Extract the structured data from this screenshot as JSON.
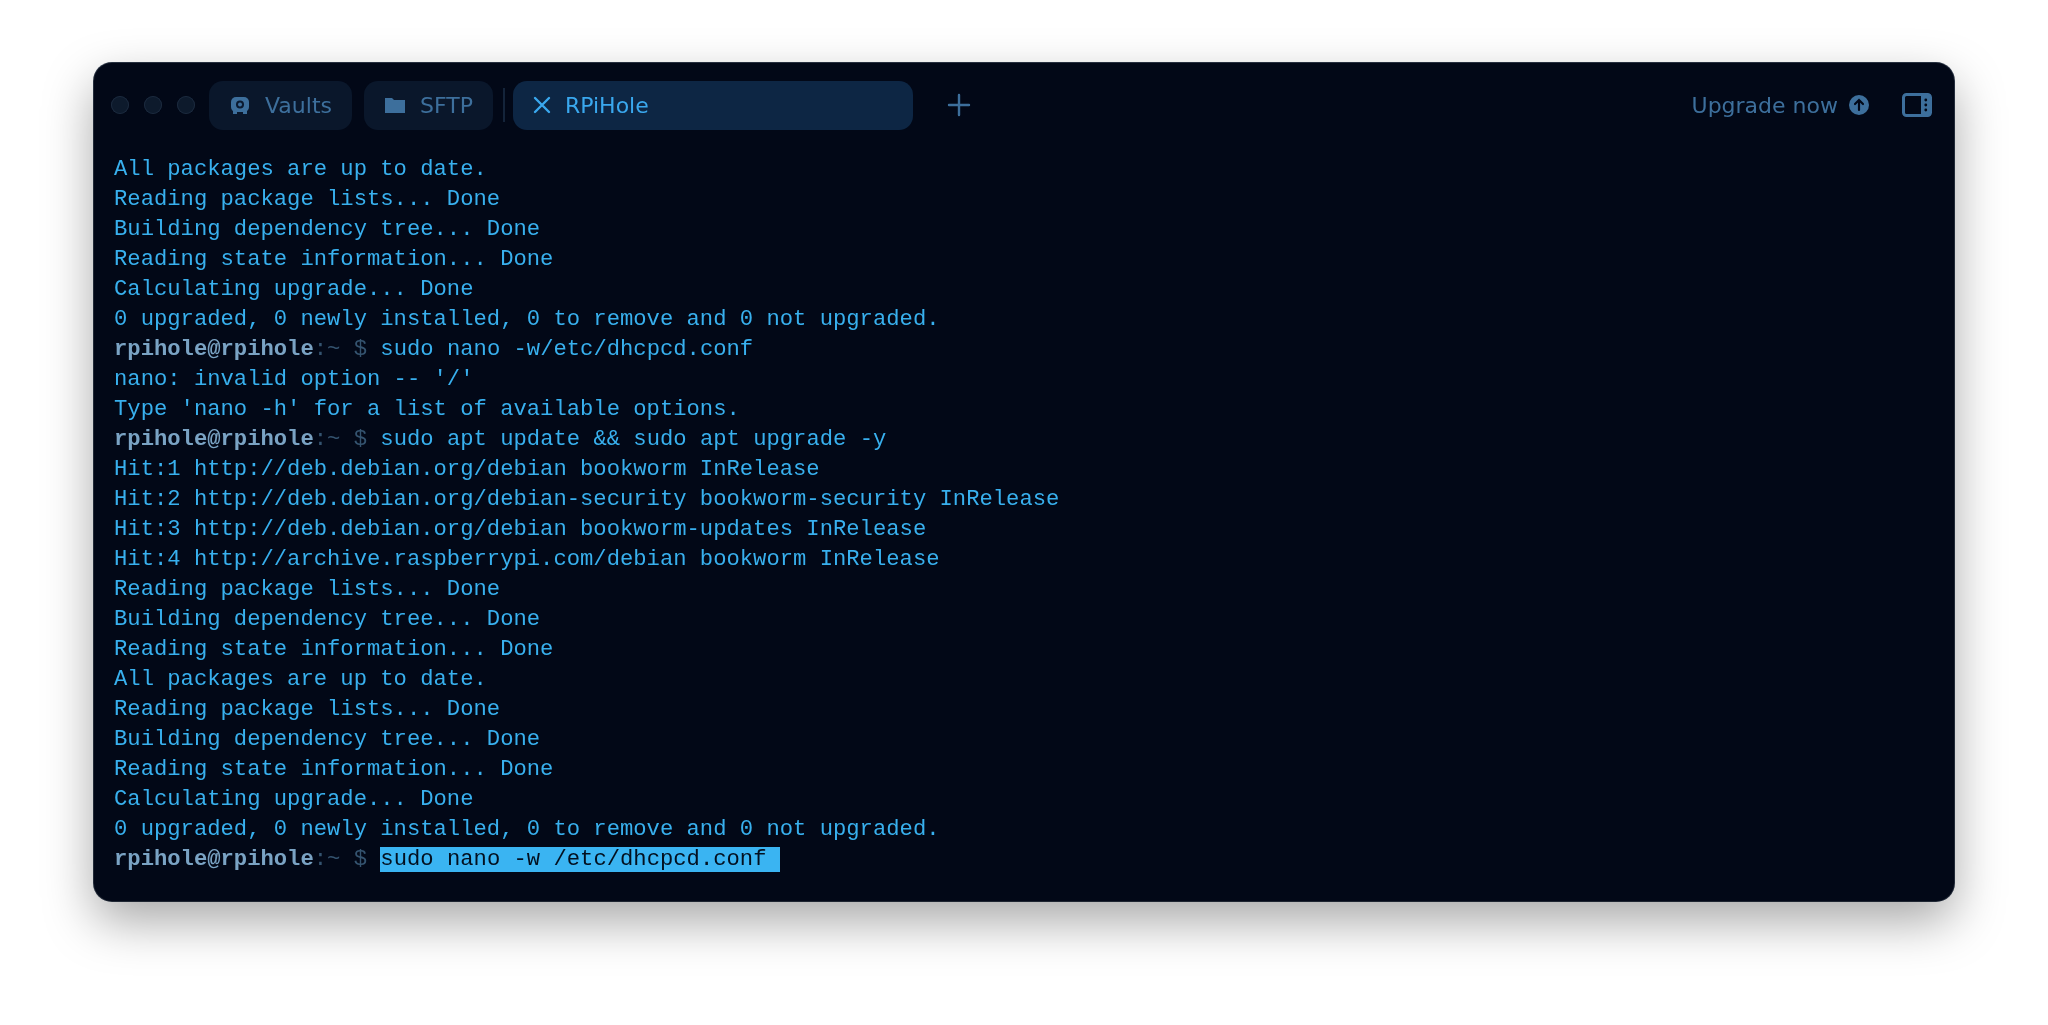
{
  "tabs": [
    {
      "label": "Vaults",
      "kind": "vault",
      "selected": false
    },
    {
      "label": "SFTP",
      "kind": "folder",
      "selected": false
    },
    {
      "label": "RPiHole",
      "kind": "session",
      "selected": true
    }
  ],
  "upgrade_link": "Upgrade now",
  "terminal": {
    "lines": [
      {
        "kind": "output",
        "text": "All packages are up to date."
      },
      {
        "kind": "output",
        "text": "Reading package lists... Done"
      },
      {
        "kind": "output",
        "text": "Building dependency tree... Done"
      },
      {
        "kind": "output",
        "text": "Reading state information... Done"
      },
      {
        "kind": "output",
        "text": "Calculating upgrade... Done"
      },
      {
        "kind": "output",
        "text": "0 upgraded, 0 newly installed, 0 to remove and 0 not upgraded."
      },
      {
        "kind": "prompt",
        "user": "rpihole@rpihole",
        "path": ":~",
        "symbol": "$",
        "command": "sudo nano -w/etc/dhcpcd.conf",
        "selected": false
      },
      {
        "kind": "output",
        "text": "nano: invalid option -- '/'"
      },
      {
        "kind": "output",
        "text": "Type 'nano -h' for a list of available options."
      },
      {
        "kind": "prompt",
        "user": "rpihole@rpihole",
        "path": ":~",
        "symbol": "$",
        "command": "sudo apt update && sudo apt upgrade -y",
        "selected": false
      },
      {
        "kind": "output",
        "text": "Hit:1 http://deb.debian.org/debian bookworm InRelease"
      },
      {
        "kind": "output",
        "text": "Hit:2 http://deb.debian.org/debian-security bookworm-security InRelease"
      },
      {
        "kind": "output",
        "text": "Hit:3 http://deb.debian.org/debian bookworm-updates InRelease"
      },
      {
        "kind": "output",
        "text": "Hit:4 http://archive.raspberrypi.com/debian bookworm InRelease"
      },
      {
        "kind": "output",
        "text": "Reading package lists... Done"
      },
      {
        "kind": "output",
        "text": "Building dependency tree... Done"
      },
      {
        "kind": "output",
        "text": "Reading state information... Done"
      },
      {
        "kind": "output",
        "text": "All packages are up to date."
      },
      {
        "kind": "output",
        "text": "Reading package lists... Done"
      },
      {
        "kind": "output",
        "text": "Building dependency tree... Done"
      },
      {
        "kind": "output",
        "text": "Reading state information... Done"
      },
      {
        "kind": "output",
        "text": "Calculating upgrade... Done"
      },
      {
        "kind": "output",
        "text": "0 upgraded, 0 newly installed, 0 to remove and 0 not upgraded."
      },
      {
        "kind": "prompt",
        "user": "rpihole@rpihole",
        "path": ":~",
        "symbol": "$",
        "command": "sudo nano -w /etc/dhcpcd.conf ",
        "selected": true
      }
    ]
  }
}
